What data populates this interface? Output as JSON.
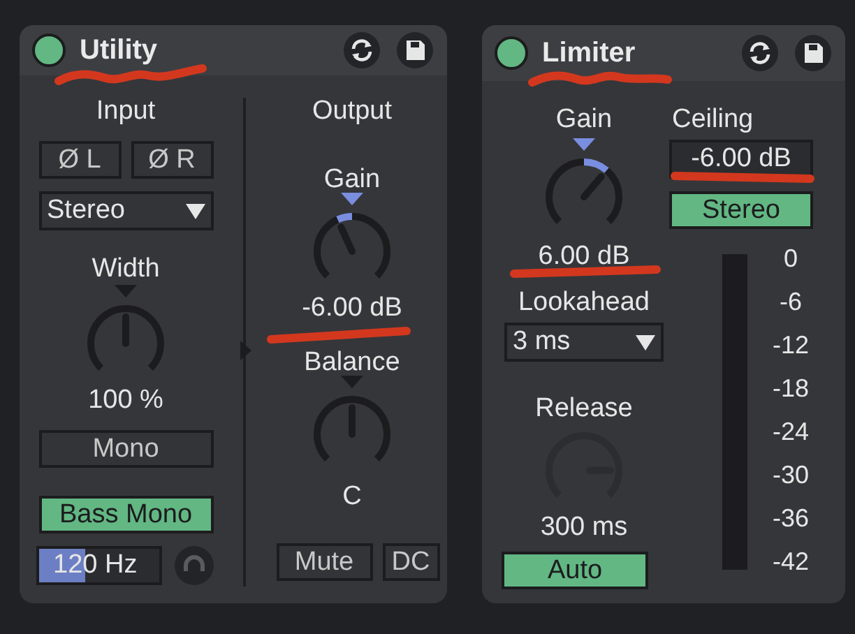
{
  "utility": {
    "title": "Utility",
    "on": true,
    "input": {
      "heading": "Input",
      "phase_left": {
        "label": "Ø L",
        "on": false
      },
      "phase_right": {
        "label": "Ø R",
        "on": false
      },
      "channel_mode": "Stereo",
      "width": {
        "label": "Width",
        "level": 0.5,
        "reading": "100 %",
        "disabled": false
      },
      "mono": {
        "label": "Mono",
        "on": false
      },
      "bass_mono": {
        "label": "Bass Mono",
        "on": true
      },
      "bass_freq": {
        "value": "120 Hz",
        "level": 0.38
      }
    },
    "output": {
      "heading": "Output",
      "gain": {
        "label": "Gain",
        "level": 0.41,
        "reading": "-6.00 dB",
        "disabled": false
      },
      "balance": {
        "label": "Balance",
        "level": 0.5,
        "reading": "C",
        "disabled": false
      },
      "mute": {
        "label": "Mute",
        "on": false
      },
      "dc": {
        "label": "DC",
        "on": false
      }
    }
  },
  "limiter": {
    "title": "Limiter",
    "on": true,
    "gain": {
      "label": "Gain",
      "level": 0.65,
      "reading": "6.00 dB",
      "disabled": false
    },
    "lookahead": {
      "label": "Lookahead",
      "value": "3 ms"
    },
    "release": {
      "label": "Release",
      "level": 0.83,
      "reading": "300 ms",
      "disabled": true
    },
    "auto": {
      "label": "Auto",
      "on": true
    },
    "ceiling": {
      "label": "Ceiling",
      "value": "-6.00 dB"
    },
    "stereo": {
      "label": "Stereo",
      "on": true
    },
    "meter_scale": [
      "0",
      "-6",
      "-12",
      "-18",
      "-24",
      "-30",
      "-36",
      "-42"
    ]
  }
}
